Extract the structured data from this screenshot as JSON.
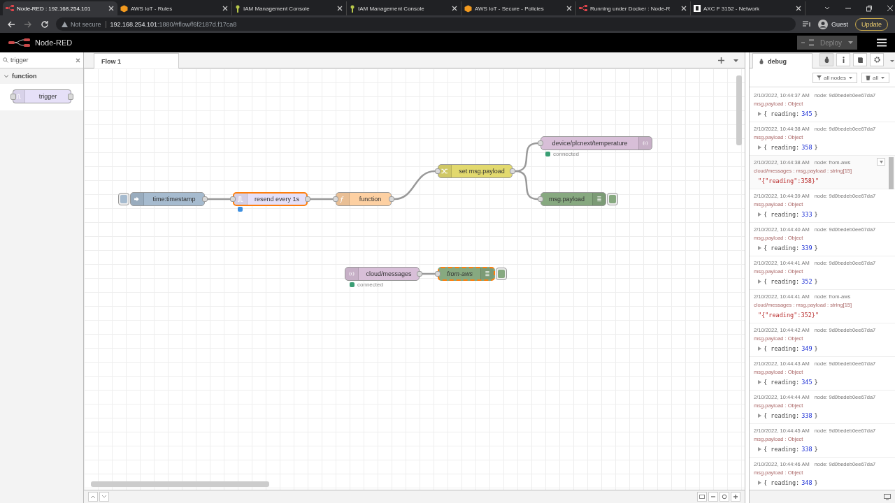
{
  "browser": {
    "tabs": [
      {
        "title": "Node-RED : 192.168.254.101",
        "selected": true
      },
      {
        "title": "AWS IoT - Rules",
        "selected": false
      },
      {
        "title": "IAM Management Console",
        "selected": false
      },
      {
        "title": "IAM Management Console",
        "selected": false
      },
      {
        "title": "AWS IoT - Secure - Policies",
        "selected": false
      },
      {
        "title": "Running under Docker : Node-R",
        "selected": false
      },
      {
        "title": "AXC F 3152 - Network",
        "selected": false
      }
    ],
    "address": {
      "security": "Not secure",
      "host": "192.168.254.101",
      "path": ":1880/#flow/f6f2187d.f17ca8"
    },
    "profile": "Guest",
    "update": "Update"
  },
  "header": {
    "title": "Node-RED",
    "deploy": {
      "label": "Deploy",
      "disabled": true
    }
  },
  "palette": {
    "search": {
      "value": "trigger"
    },
    "categories": [
      {
        "label": "function",
        "expanded": true,
        "nodes": [
          {
            "label": "trigger",
            "color": "#e6e0f8"
          }
        ]
      }
    ]
  },
  "workspace": {
    "tabs": [
      {
        "label": "Flow 1",
        "selected": true
      }
    ],
    "nodes": [
      {
        "label": "time:timestamp",
        "kind": "inject",
        "color": "#a6bbcf",
        "selected": false,
        "italic": false
      },
      {
        "label": "resend every 1s",
        "kind": "trigger",
        "color": "#e6e0f8",
        "selected": true,
        "italic": false,
        "status": {
          "color": "#3d8fe0"
        }
      },
      {
        "label": "function",
        "kind": "function",
        "color": "#fdd0a2",
        "selected": false,
        "italic": false
      },
      {
        "label": "set msg.payload",
        "kind": "change",
        "color": "#e2d96e",
        "selected": false,
        "italic": false
      },
      {
        "label": "device/plcnext/temperature",
        "kind": "mqtt-out",
        "color": "#d8bfd8",
        "selected": false,
        "italic": false,
        "status": {
          "color": "#3a9e74",
          "text": "connected"
        }
      },
      {
        "label": "msg.payload",
        "kind": "debug",
        "color": "#87a980",
        "selected": false,
        "italic": false
      },
      {
        "label": "cloud/messages",
        "kind": "mqtt-in",
        "color": "#d8bfd8",
        "selected": false,
        "italic": false,
        "status": {
          "color": "#3a9e74",
          "text": "connected"
        }
      },
      {
        "label": "from-aws",
        "kind": "debug",
        "color": "#87a980",
        "selected": true,
        "italic": true
      }
    ]
  },
  "sidebar": {
    "tabs": [
      {
        "label": "debug",
        "selected": true
      }
    ],
    "filter": "all nodes",
    "clear": "all",
    "messages": [
      {
        "time": "2/10/2022, 10:44:37 AM",
        "node": "node: 9d0bedeb0ee67da7",
        "meta": "msg.payload : Object",
        "kind": "object",
        "before": "{ reading:",
        "number": "345",
        "after": "}",
        "hovered": false
      },
      {
        "time": "2/10/2022, 10:44:38 AM",
        "node": "node: 9d0bedeb0ee67da7",
        "meta": "msg.payload : Object",
        "kind": "object",
        "before": "{ reading:",
        "number": "358",
        "after": "}",
        "hovered": false
      },
      {
        "time": "2/10/2022, 10:44:38 AM",
        "node": "node: from-aws",
        "meta": "cloud/messages : msg.payload : string[15]",
        "kind": "string",
        "value": "\"{\"reading\":358}\"",
        "hovered": true
      },
      {
        "time": "2/10/2022, 10:44:39 AM",
        "node": "node: 9d0bedeb0ee67da7",
        "meta": "msg.payload : Object",
        "kind": "object",
        "before": "{ reading:",
        "number": "333",
        "after": "}",
        "hovered": false
      },
      {
        "time": "2/10/2022, 10:44:40 AM",
        "node": "node: 9d0bedeb0ee67da7",
        "meta": "msg.payload : Object",
        "kind": "object",
        "before": "{ reading:",
        "number": "339",
        "after": "}",
        "hovered": false
      },
      {
        "time": "2/10/2022, 10:44:41 AM",
        "node": "node: 9d0bedeb0ee67da7",
        "meta": "msg.payload : Object",
        "kind": "object",
        "before": "{ reading:",
        "number": "352",
        "after": "}",
        "hovered": false
      },
      {
        "time": "2/10/2022, 10:44:41 AM",
        "node": "node: from-aws",
        "meta": "cloud/messages : msg.payload : string[15]",
        "kind": "string",
        "value": "\"{\"reading\":352}\"",
        "hovered": false
      },
      {
        "time": "2/10/2022, 10:44:42 AM",
        "node": "node: 9d0bedeb0ee67da7",
        "meta": "msg.payload : Object",
        "kind": "object",
        "before": "{ reading:",
        "number": "349",
        "after": "}",
        "hovered": false
      },
      {
        "time": "2/10/2022, 10:44:43 AM",
        "node": "node: 9d0bedeb0ee67da7",
        "meta": "msg.payload : Object",
        "kind": "object",
        "before": "{ reading:",
        "number": "345",
        "after": "}",
        "hovered": false
      },
      {
        "time": "2/10/2022, 10:44:44 AM",
        "node": "node: 9d0bedeb0ee67da7",
        "meta": "msg.payload : Object",
        "kind": "object",
        "before": "{ reading:",
        "number": "338",
        "after": "}",
        "hovered": false
      },
      {
        "time": "2/10/2022, 10:44:45 AM",
        "node": "node: 9d0bedeb0ee67da7",
        "meta": "msg.payload : Object",
        "kind": "object",
        "before": "{ reading:",
        "number": "338",
        "after": "}",
        "hovered": false
      },
      {
        "time": "2/10/2022, 10:44:46 AM",
        "node": "node: 9d0bedeb0ee67da7",
        "meta": "msg.payload : Object",
        "kind": "object",
        "before": "{ reading:",
        "number": "348",
        "after": "}",
        "hovered": false
      }
    ]
  }
}
